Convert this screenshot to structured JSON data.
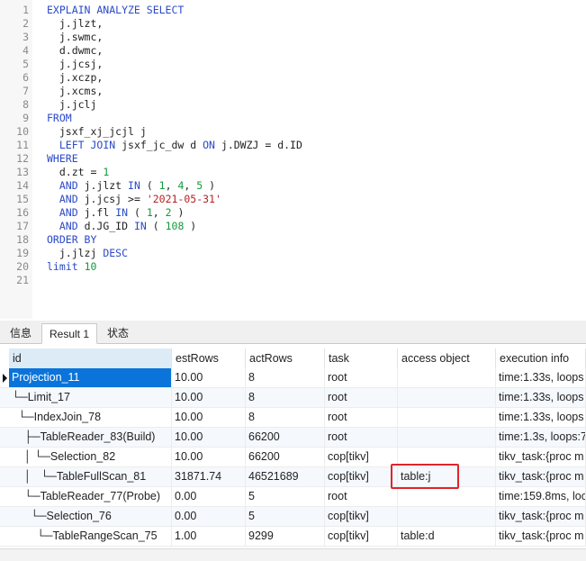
{
  "editor": {
    "lines": [
      [
        {
          "t": "EXPLAIN ANALYZE SELECT",
          "c": "kw"
        }
      ],
      [
        {
          "t": "  j.jlzt,",
          "c": ""
        }
      ],
      [
        {
          "t": "  j.swmc,",
          "c": ""
        }
      ],
      [
        {
          "t": "  d.dwmc,",
          "c": ""
        }
      ],
      [
        {
          "t": "  j.jcsj,",
          "c": ""
        }
      ],
      [
        {
          "t": "  j.xczp,",
          "c": ""
        }
      ],
      [
        {
          "t": "  j.xcms,",
          "c": ""
        }
      ],
      [
        {
          "t": "  j.jclj",
          "c": ""
        }
      ],
      [
        {
          "t": "FROM",
          "c": "kw"
        }
      ],
      [
        {
          "t": "  jsxf_xj_jcjl j",
          "c": ""
        }
      ],
      [
        {
          "t": "  ",
          "c": ""
        },
        {
          "t": "LEFT JOIN",
          "c": "kw"
        },
        {
          "t": " jsxf_jc_dw d ",
          "c": ""
        },
        {
          "t": "ON",
          "c": "kw"
        },
        {
          "t": " j.DWZJ = d.ID",
          "c": ""
        }
      ],
      [
        {
          "t": "WHERE",
          "c": "kw"
        }
      ],
      [
        {
          "t": "  d.zt = ",
          "c": ""
        },
        {
          "t": "1",
          "c": "num"
        }
      ],
      [
        {
          "t": "  ",
          "c": ""
        },
        {
          "t": "AND",
          "c": "kw"
        },
        {
          "t": " j.jlzt ",
          "c": ""
        },
        {
          "t": "IN",
          "c": "kw"
        },
        {
          "t": " ( ",
          "c": ""
        },
        {
          "t": "1",
          "c": "num"
        },
        {
          "t": ", ",
          "c": ""
        },
        {
          "t": "4",
          "c": "num"
        },
        {
          "t": ", ",
          "c": ""
        },
        {
          "t": "5",
          "c": "num"
        },
        {
          "t": " )",
          "c": ""
        }
      ],
      [
        {
          "t": "  ",
          "c": ""
        },
        {
          "t": "AND",
          "c": "kw"
        },
        {
          "t": " j.jcsj >= ",
          "c": ""
        },
        {
          "t": "'2021-05-31'",
          "c": "str"
        }
      ],
      [
        {
          "t": "  ",
          "c": ""
        },
        {
          "t": "AND",
          "c": "kw"
        },
        {
          "t": " j.fl ",
          "c": ""
        },
        {
          "t": "IN",
          "c": "kw"
        },
        {
          "t": " ( ",
          "c": ""
        },
        {
          "t": "1",
          "c": "num"
        },
        {
          "t": ", ",
          "c": ""
        },
        {
          "t": "2",
          "c": "num"
        },
        {
          "t": " )",
          "c": ""
        }
      ],
      [
        {
          "t": "  ",
          "c": ""
        },
        {
          "t": "AND",
          "c": "kw"
        },
        {
          "t": " d.JG_ID ",
          "c": ""
        },
        {
          "t": "IN",
          "c": "kw"
        },
        {
          "t": " ( ",
          "c": ""
        },
        {
          "t": "108",
          "c": "num"
        },
        {
          "t": " )",
          "c": ""
        }
      ],
      [
        {
          "t": "ORDER BY",
          "c": "kw"
        }
      ],
      [
        {
          "t": "  j.jlzj ",
          "c": ""
        },
        {
          "t": "DESC",
          "c": "kw"
        }
      ],
      [
        {
          "t": "limit",
          "c": "kw"
        },
        {
          "t": " ",
          "c": ""
        },
        {
          "t": "10",
          "c": "num"
        }
      ],
      []
    ]
  },
  "tabs": {
    "info": "信息",
    "result1": "Result 1",
    "status": "状态"
  },
  "grid": {
    "columns": [
      "id",
      "estRows",
      "actRows",
      "task",
      "access object",
      "execution info"
    ],
    "rows": [
      [
        "Projection_11",
        "10.00",
        "8",
        "root",
        "",
        "time:1.33s, loops"
      ],
      [
        "└─Limit_17",
        "10.00",
        "8",
        "root",
        "",
        "time:1.33s, loops"
      ],
      [
        "  └─IndexJoin_78",
        "10.00",
        "8",
        "root",
        "",
        "time:1.33s, loops"
      ],
      [
        "    ├─TableReader_83(Build)",
        "10.00",
        "66200",
        "root",
        "",
        "time:1.3s, loops:7"
      ],
      [
        "    │ └─Selection_82",
        "10.00",
        "66200",
        "cop[tikv]",
        "",
        "tikv_task:{proc m"
      ],
      [
        "    │   └─TableFullScan_81",
        "31871.74",
        "46521689",
        "cop[tikv]",
        "table:j",
        "tikv_task:{proc m"
      ],
      [
        "    └─TableReader_77(Probe)",
        "0.00",
        "5",
        "root",
        "",
        "time:159.8ms, loo"
      ],
      [
        "      └─Selection_76",
        "0.00",
        "5",
        "cop[tikv]",
        "",
        "tikv_task:{proc m"
      ],
      [
        "        └─TableRangeScan_75",
        "1.00",
        "9299",
        "cop[tikv]",
        "table:d",
        "tikv_task:{proc m"
      ]
    ]
  }
}
